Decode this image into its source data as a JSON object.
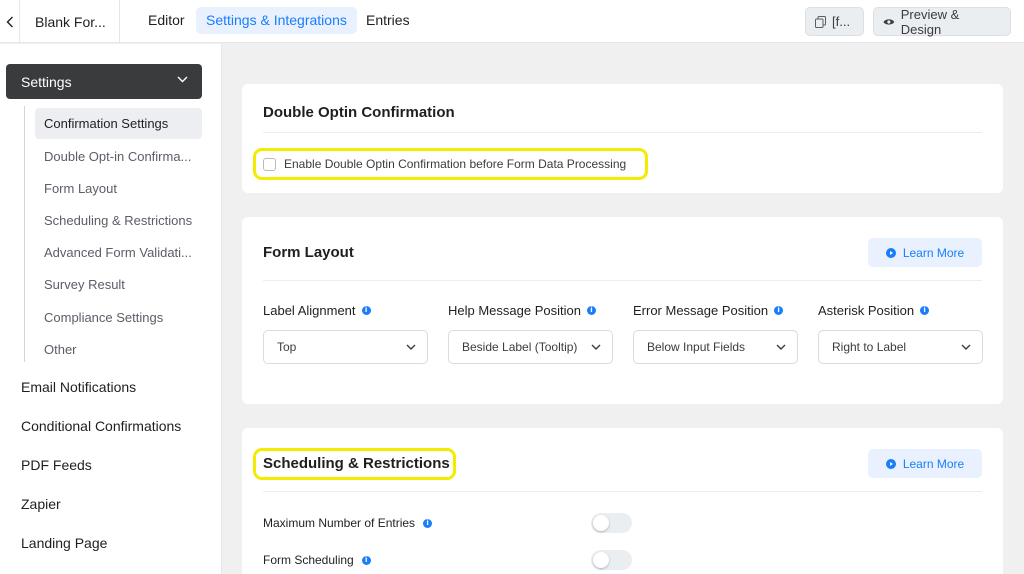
{
  "topbar": {
    "form_title": "Blank For...",
    "tabs": [
      {
        "label": "Editor"
      },
      {
        "label": "Settings & Integrations"
      },
      {
        "label": "Entries"
      }
    ],
    "shortcode_label": "[f...",
    "preview_label": "Preview & Design"
  },
  "sidebar": {
    "settings_label": "Settings",
    "sub_items": [
      {
        "label": "Confirmation Settings"
      },
      {
        "label": "Double Opt-in Confirma..."
      },
      {
        "label": "Form Layout"
      },
      {
        "label": "Scheduling & Restrictions"
      },
      {
        "label": "Advanced Form Validati..."
      },
      {
        "label": "Survey Result"
      },
      {
        "label": "Compliance Settings"
      },
      {
        "label": "Other"
      }
    ],
    "main_items": [
      {
        "label": "Email Notifications"
      },
      {
        "label": "Conditional Confirmations"
      },
      {
        "label": "PDF Feeds"
      },
      {
        "label": "Zapier"
      },
      {
        "label": "Landing Page"
      }
    ]
  },
  "double_optin": {
    "title": "Double Optin Confirmation",
    "checkbox_label": "Enable Double Optin Confirmation before Form Data Processing",
    "checked": false
  },
  "form_layout": {
    "title": "Form Layout",
    "learn_more": "Learn More",
    "fields": [
      {
        "label": "Label Alignment",
        "value": "Top"
      },
      {
        "label": "Help Message Position",
        "value": "Beside Label (Tooltip)"
      },
      {
        "label": "Error Message Position",
        "value": "Below Input Fields"
      },
      {
        "label": "Asterisk Position",
        "value": "Right to Label"
      }
    ]
  },
  "scheduling": {
    "title": "Scheduling & Restrictions",
    "learn_more": "Learn More",
    "toggles": [
      {
        "label": "Maximum Number of Entries",
        "enabled": false
      },
      {
        "label": "Form Scheduling",
        "enabled": false
      }
    ]
  },
  "colors": {
    "accent": "#1a7efb",
    "highlight": "#f3ec00",
    "sidebar_active_bg": "#3a3b3d"
  }
}
